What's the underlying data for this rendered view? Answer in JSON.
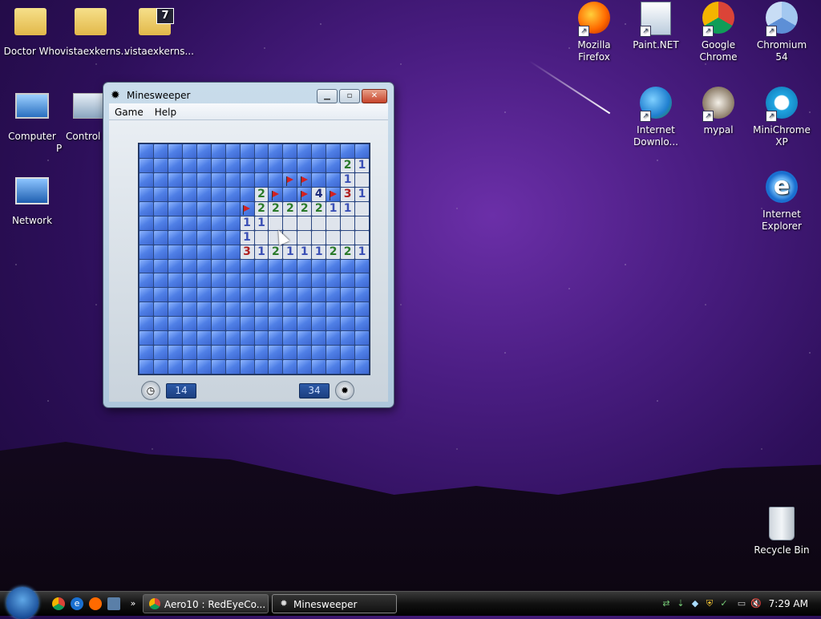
{
  "desktop": {
    "icons": [
      {
        "label": "Doctor Who",
        "icon": "folder-icon"
      },
      {
        "label": "vistaexkerns...",
        "icon": "folder-icon"
      },
      {
        "label": "vistaexkerns...",
        "icon": "folder-7-icon"
      },
      {
        "label": "Computer",
        "icon": "computer-icon"
      },
      {
        "label": "Control P",
        "icon": "control-panel-icon"
      },
      {
        "label": "Network",
        "icon": "network-icon"
      },
      {
        "label": "Mozilla Firefox",
        "icon": "firefox-icon"
      },
      {
        "label": "Paint.NET",
        "icon": "paintnet-icon"
      },
      {
        "label": "Google Chrome",
        "icon": "chrome-icon"
      },
      {
        "label": "Chromium 54",
        "icon": "chromium-icon"
      },
      {
        "label": "Internet Downlo...",
        "icon": "internet-download-icon"
      },
      {
        "label": "mypal",
        "icon": "mypal-icon"
      },
      {
        "label": "MiniChrome XP",
        "icon": "minichrome-icon"
      },
      {
        "label": "Internet Explorer",
        "icon": "ie-icon"
      },
      {
        "label": "Recycle Bin",
        "icon": "recycle-bin-icon"
      }
    ]
  },
  "window": {
    "title": "Minesweeper",
    "menu": [
      "Game",
      "Help"
    ],
    "timer": "14",
    "mines": "34",
    "board": [
      "################",
      "##############21",
      "##########FF##1.",
      "########2F#F4F31",
      "#######F2222211.",
      "#######11.......",
      "#######1........",
      "#######312111221",
      "################",
      "################",
      "################",
      "################",
      "################",
      "################",
      "################",
      "################"
    ]
  },
  "taskbar": {
    "buttons": [
      {
        "label": "Aero10 : RedEyeCo...",
        "icon": "chrome-icon"
      },
      {
        "label": "Minesweeper",
        "icon": "minesweeper-icon"
      }
    ],
    "clock": "7:29 AM"
  }
}
